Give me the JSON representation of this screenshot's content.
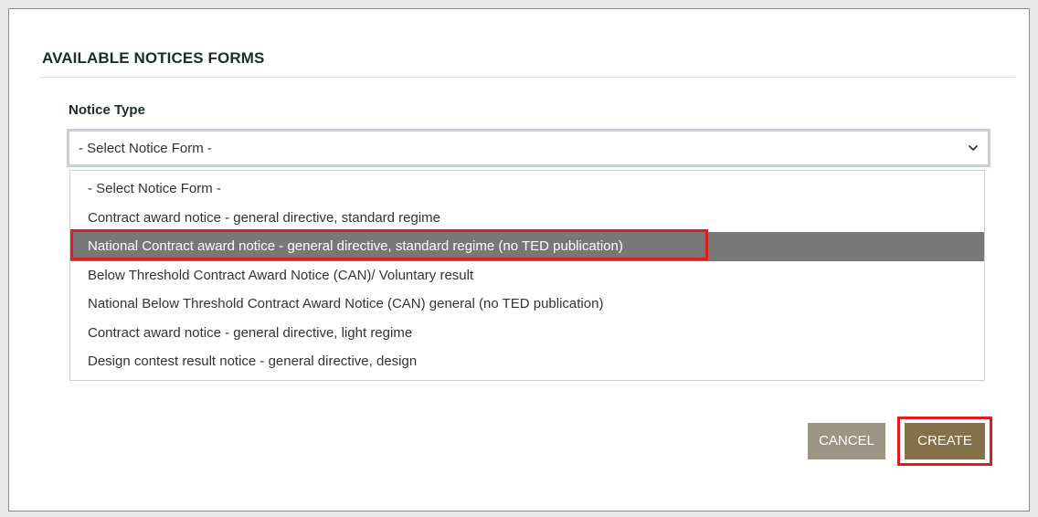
{
  "modal": {
    "title": "AVAILABLE NOTICES FORMS"
  },
  "form": {
    "label": "Notice Type",
    "selected_value": "- Select Notice Form -",
    "options": [
      "- Select Notice Form -",
      "Contract award notice - general directive, standard regime",
      "National Contract award notice - general directive, standard regime (no TED publication)",
      "Below Threshold Contract Award Notice (CAN)/ Voluntary result",
      "National Below Threshold Contract Award Notice (CAN) general (no TED publication)",
      "Contract award notice - general directive, light regime",
      "Design contest result notice - general directive, design"
    ],
    "highlighted_option_index": 2
  },
  "buttons": {
    "cancel_label": "CANCEL",
    "create_label": "CREATE"
  },
  "icons": {
    "select_chevron": "chevron-down-icon"
  },
  "colors": {
    "highlight_outline": "#d92020",
    "option_hover_bg": "#787878",
    "cancel_bg": "#9b9585",
    "create_bg": "#84704a",
    "heading_text": "#1c2e24"
  }
}
